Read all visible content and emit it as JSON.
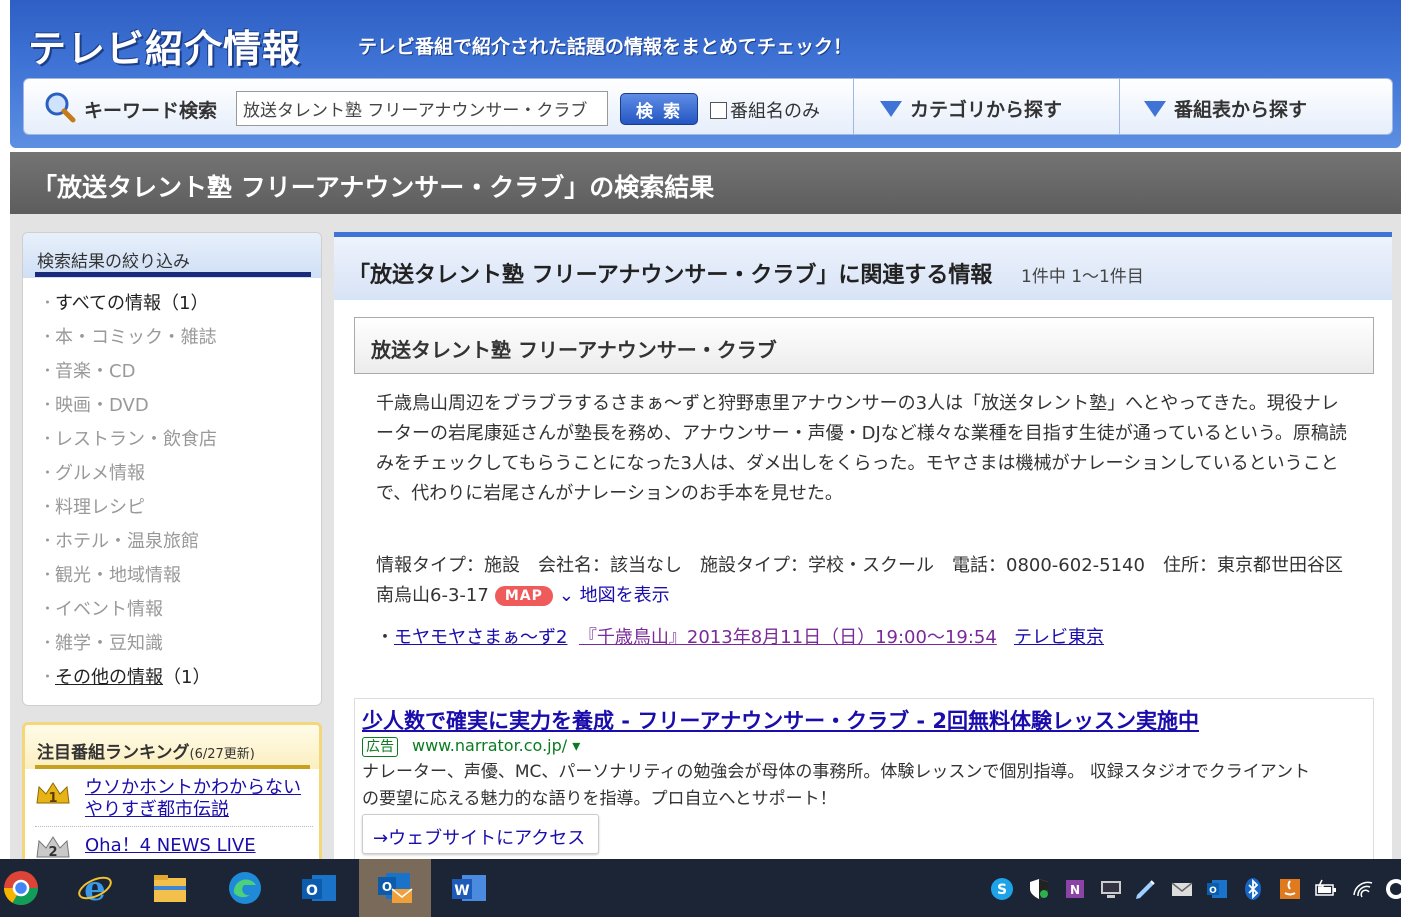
{
  "header": {
    "logo": "テレビ紹介情報",
    "tagline": "テレビ番組で紹介された話題の情報をまとめてチェック！",
    "search_label": "キーワード検索",
    "search_value": "放送タレント塾 フリーアナウンサー・クラブ",
    "search_button": "検 索",
    "program_only": "番組名のみ",
    "nav_category": "カテゴリから探す",
    "nav_schedule": "番組表から探す"
  },
  "page_title": "「放送タレント塾 フリーアナウンサー・クラブ」の検索結果",
  "sidebar": {
    "filter_title": "検索結果の絞り込み",
    "items": [
      {
        "label": "すべての情報（1）"
      },
      {
        "label": "本・コミック・雑誌"
      },
      {
        "label": "音楽・CD"
      },
      {
        "label": "映画・DVD"
      },
      {
        "label": "レストラン・飲食店"
      },
      {
        "label": "グルメ情報"
      },
      {
        "label": "料理レシピ"
      },
      {
        "label": "ホテル・温泉旅館"
      },
      {
        "label": "観光・地域情報"
      },
      {
        "label": "イベント情報"
      },
      {
        "label": "雑学・豆知識"
      },
      {
        "label": "その他の情報",
        "count": "（1）"
      }
    ],
    "ranking_title": "注目番組ランキング",
    "ranking_updated": "(6/27更新)",
    "ranking": [
      {
        "rank": "1",
        "title": "ウソかホントかわからない やりすぎ都市伝説"
      },
      {
        "rank": "2",
        "title": "Oha！4 NEWS LIVE"
      }
    ]
  },
  "main": {
    "title": "「放送タレント塾 フリーアナウンサー・クラブ」に関連する情報",
    "count": "1件中 1〜1件目",
    "item_title": "放送タレント塾 フリーアナウンサー・クラブ",
    "description": "千歳鳥山周辺をブラブラするさまぁ〜ずと狩野恵里アナウンサーの3人は「放送タレント塾」へとやってきた。現役ナレーターの岩尾康延さんが塾長を務め、アナウンサー・声優・DJなど様々な業種を目指す生徒が通っているという。原稿読みをチェックしてもらうことになった3人は、ダメ出しをくらった。モヤさまは機械がナレーションしているということで、代わりに岩尾さんがナレーションのお手本を見せた。",
    "info": "情報タイプ：施設　会社名：該当なし　施設タイプ：学校・スクール　電話：0800-602-5140　住所：東京都世田谷区南烏山6-3-17",
    "map_badge": "MAP",
    "map_link": "地図を表示",
    "episode_bullet": "・",
    "episode_program": "モヤモヤさまぁ〜ず2",
    "episode_title": "『千歳鳥山』2013年8月11日（日）19:00〜19:54",
    "episode_channel": "テレビ東京"
  },
  "ad": {
    "title": "少人数で確実に実力を養成 - フリーアナウンサー・クラブ - 2回無料体験レッスン実施中",
    "badge": "広告",
    "url": "www.narrator.co.jp/ ▾",
    "text": "ナレーター、声優、MC、パーソナリティの勉強会が母体の事務所。体験レッスンで個別指導。 収録スタジオでクライアントの要望に応える魅力的な語りを指導。プロ自立へとサポート！",
    "button": "ウェブサイトにアクセス"
  },
  "taskbar": {
    "apps": [
      "chrome-icon",
      "internet-explorer-icon",
      "file-explorer-icon",
      "edge-icon",
      "outlook-icon",
      "outlook-mail-icon",
      "word-icon"
    ],
    "tray": [
      "skype-icon",
      "security-icon",
      "onenote-icon",
      "network-display-icon",
      "pen-icon",
      "mail-icon",
      "outlook-tray-icon",
      "bluetooth-icon",
      "java-icon",
      "battery-icon",
      "wifi-icon",
      "edge-tray-icon"
    ]
  }
}
